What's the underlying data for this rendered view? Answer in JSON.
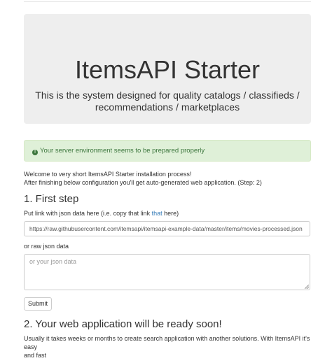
{
  "jumbotron": {
    "title": "ItemsAPI Starter",
    "subtitle_line1": "This is the system designed for quality catalogs / classifieds /",
    "subtitle_line2": "recommendations / marketplaces"
  },
  "alert": {
    "icon": "info-circle-icon",
    "text": "Your server environment seems to be prepared properly",
    "color": "#3c763d",
    "background": "#dff0d8"
  },
  "intro": {
    "line1": "Welcome to very short ItemsAPI Starter installation process!",
    "line2": "After finishing below configuration you'll get auto-generated web application. (Step: 2)"
  },
  "step1": {
    "heading": "1. First step",
    "link_label_before": "Put link with json data here (i.e. copy that link ",
    "link_text": "that",
    "link_label_after": " here)",
    "url_value": "https://raw.githubusercontent.com/itemsapi/itemsapi-example-data/master/items/movies-processed.json",
    "raw_label": "or raw json data",
    "raw_placeholder": "or your json data",
    "submit_label": "Submit"
  },
  "step2": {
    "heading": "2. Your web application will be ready soon!",
    "line1": "Usually it takes weeks or months to create search application with another solutions. With ItemsAPI it's easy",
    "line2": "and fast"
  }
}
